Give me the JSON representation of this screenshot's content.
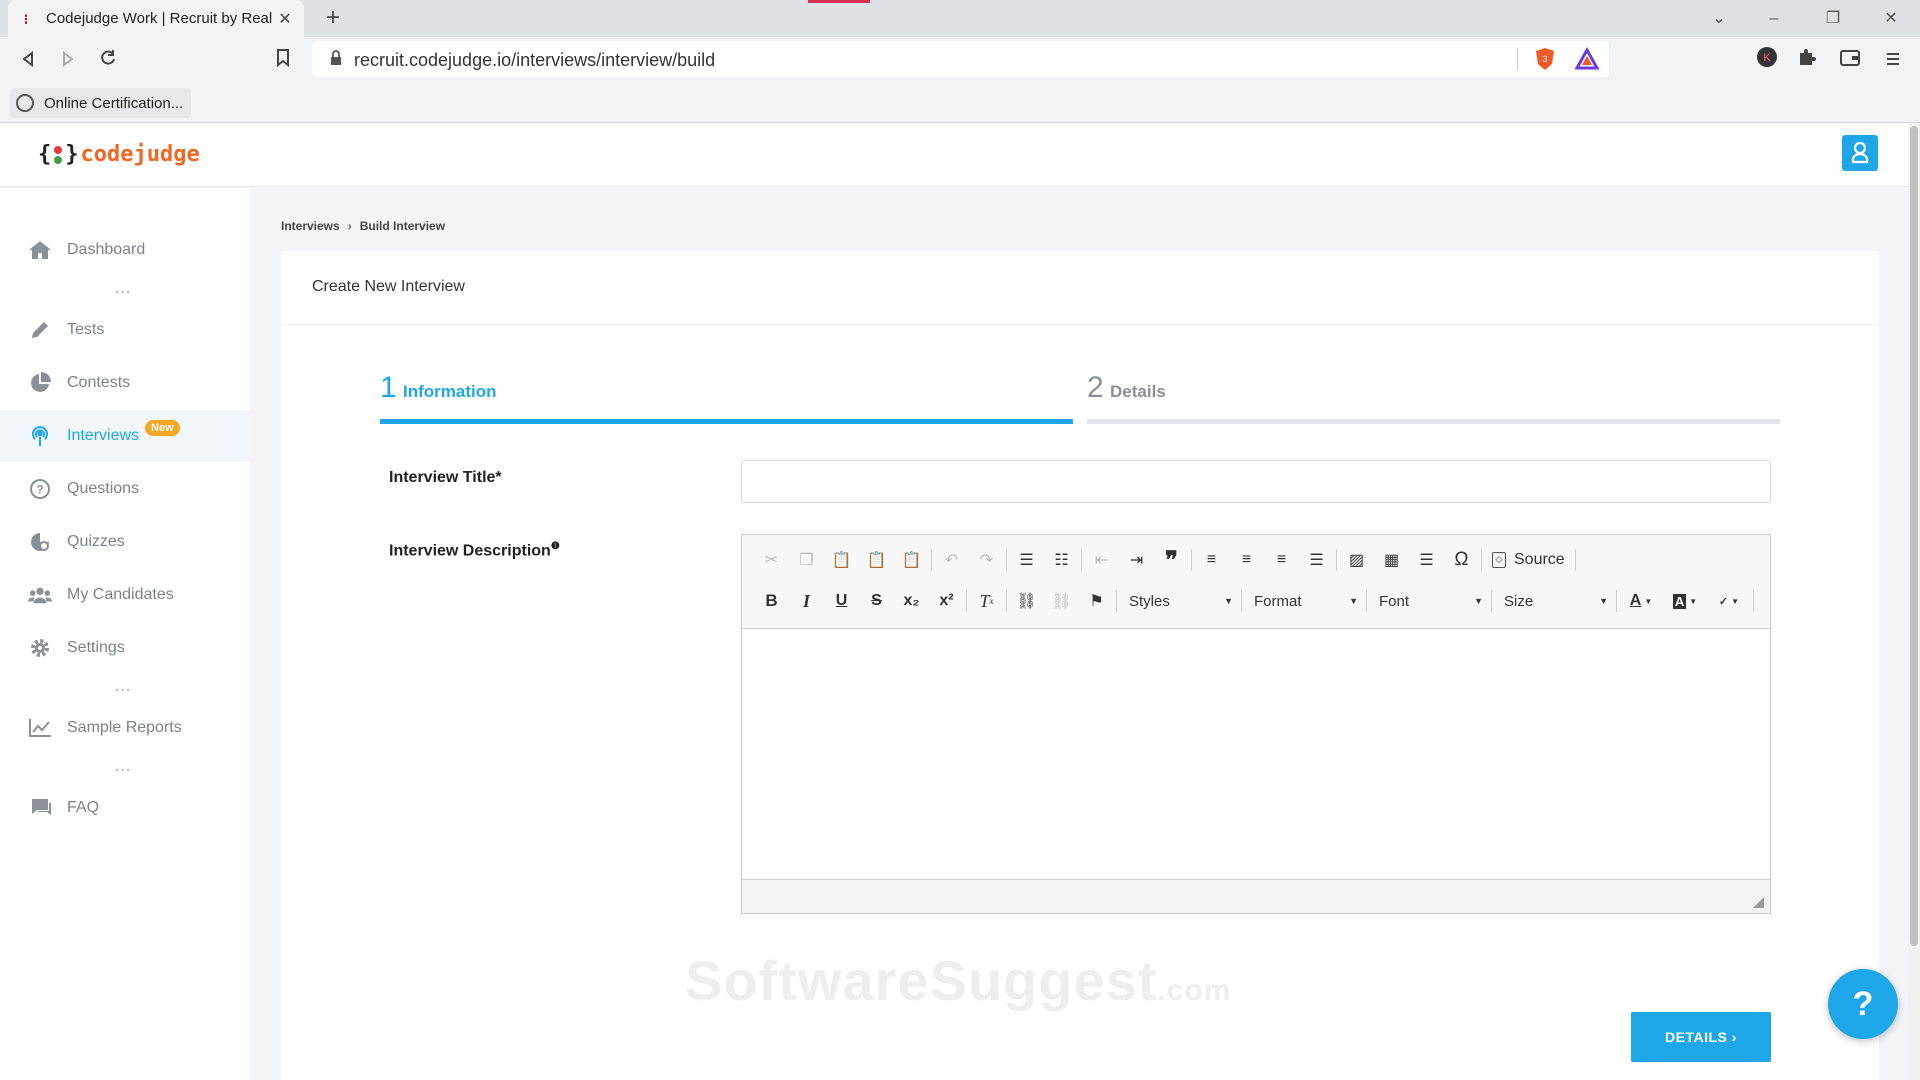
{
  "browser": {
    "tab_title": "Codejudge Work | Recruit by Real",
    "url": "recruit.codejudge.io/interviews/interview/build",
    "bookmark": "Online Certification...",
    "profile_initial": "K",
    "brave_count": "3"
  },
  "app": {
    "logo_text": "codejudge",
    "accent_color": "#1ea7e8",
    "logo_color": "#f26522"
  },
  "sidebar": {
    "items": [
      {
        "label": "Dashboard",
        "icon": "home-icon"
      },
      {
        "label": "Tests",
        "icon": "pencil-icon"
      },
      {
        "label": "Contests",
        "icon": "pie-chart-icon"
      },
      {
        "label": "Interviews",
        "icon": "podcast-icon",
        "badge": "New",
        "active": true
      },
      {
        "label": "Questions",
        "icon": "question-circle-icon"
      },
      {
        "label": "Quizzes",
        "icon": "quiz-icon"
      },
      {
        "label": "My Candidates",
        "icon": "users-icon"
      },
      {
        "label": "Settings",
        "icon": "gear-icon"
      },
      {
        "label": "Sample Reports",
        "icon": "line-chart-icon"
      },
      {
        "label": "FAQ",
        "icon": "comments-icon"
      }
    ],
    "dots": "..."
  },
  "breadcrumb": {
    "parent": "Interviews",
    "separator": "›",
    "current": "Build Interview"
  },
  "card": {
    "title": "Create New Interview"
  },
  "steps": [
    {
      "number": "1",
      "label": "Information"
    },
    {
      "number": "2",
      "label": "Details"
    }
  ],
  "form": {
    "title_label": "Interview Title",
    "required_mark": "*",
    "title_value": "",
    "description_label": "Interview Description",
    "info_mark": "❶"
  },
  "editor": {
    "source_label": "Source",
    "styles_label": "Styles",
    "format_label": "Format",
    "font_label": "Font",
    "size_label": "Size",
    "row1_icons": [
      "cut-icon",
      "copy-icon",
      "paste-icon",
      "paste-text-icon",
      "paste-word-icon",
      "undo-icon",
      "redo-icon",
      "numbered-list-icon",
      "bulleted-list-icon",
      "outdent-icon",
      "indent-icon",
      "blockquote-icon",
      "align-left-icon",
      "align-center-icon",
      "align-right-icon",
      "justify-icon",
      "image-icon",
      "table-icon",
      "horizontal-line-icon",
      "special-char-icon",
      "source-icon"
    ],
    "row2_icons": [
      "bold-icon",
      "italic-icon",
      "underline-icon",
      "strike-icon",
      "subscript-icon",
      "superscript-icon",
      "remove-format-icon",
      "link-icon",
      "unlink-icon",
      "anchor-icon",
      "text-color-icon",
      "bg-color-icon",
      "spellcheck-icon"
    ]
  },
  "actions": {
    "next_label": "DETAILS ›"
  },
  "watermark": {
    "main": "SoftwareSuggest",
    "suffix": ".com"
  },
  "help": {
    "label": "?"
  }
}
